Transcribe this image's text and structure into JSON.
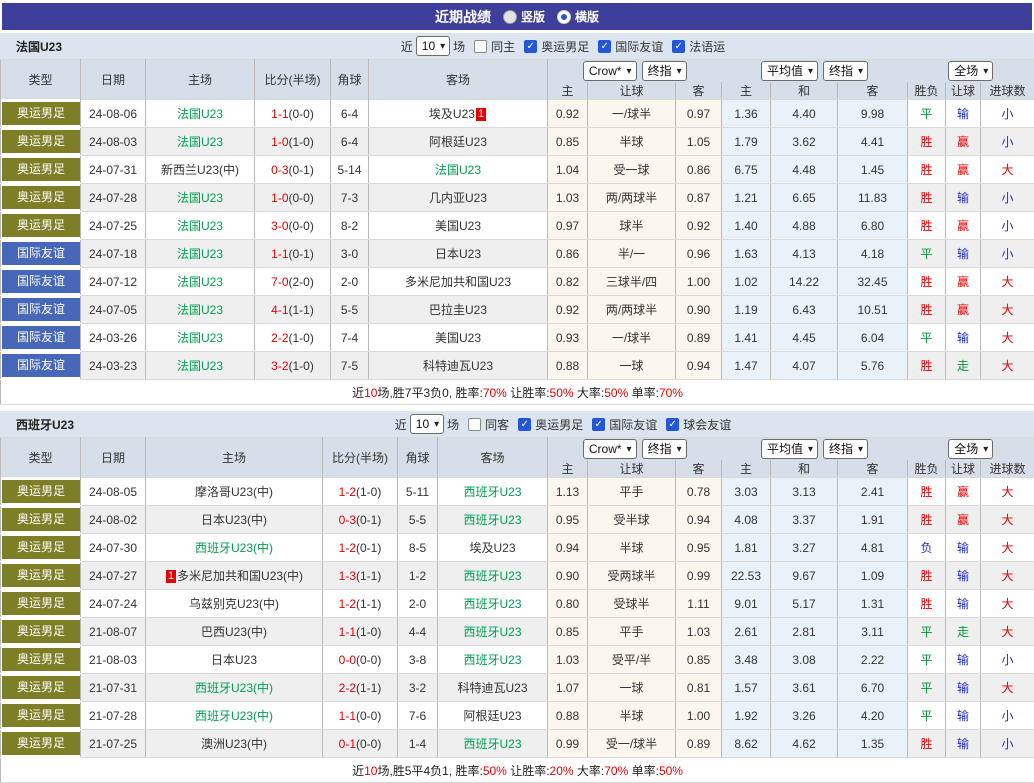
{
  "colors": {
    "titlebar": "#3e3e9b",
    "olympic_badge": "#7e7e26",
    "friendly_badge": "#4768b8",
    "team_highlight": "#00a050",
    "score_red": "#e60000",
    "result_blue": "#2230c8",
    "result_green": "#009933",
    "crow_col_bg": "#fbf6ee",
    "avg_col_bg": "#e9f2f9"
  },
  "title_bar": {
    "title": "近期战绩",
    "radio_vertical": "竖版",
    "radio_horizontal": "横版"
  },
  "table_header": {
    "type": "类型",
    "date": "日期",
    "home": "主场",
    "score": "比分(半场)",
    "corner": "角球",
    "away": "客场",
    "group1_select1": "Crow*",
    "group1_select2": "终指",
    "group1_col1": "主",
    "group1_col2": "让球",
    "group1_col3": "客",
    "group2_select1": "平均值",
    "group2_select2": "终指",
    "group2_col1": "主",
    "group2_col2": "和",
    "group2_col3": "客",
    "group3_select": "全场",
    "group3_col1": "胜负",
    "group3_col2": "让球",
    "group3_col3": "进球数"
  },
  "sections": [
    {
      "team": "法国U23",
      "filter": {
        "near": "近",
        "count": "10",
        "games": "场",
        "same": "同主",
        "leagues": [
          "奥运男足",
          "国际友谊",
          "法语运"
        ]
      },
      "rows": [
        {
          "type": "奥运男足",
          "style": "olympic",
          "date": "24-08-06",
          "home": "法国U23",
          "home_green": true,
          "home_badge": "",
          "score": "1-1",
          "half": "(0-0)",
          "corner": "6-4",
          "away": "埃及U23",
          "away_green": false,
          "away_badge": "1",
          "o1": "0.92",
          "o2": "一/球半",
          "o3": "0.97",
          "o4": "1.36",
          "o5": "4.40",
          "o6": "9.98",
          "r1": "平",
          "r1c": "green",
          "r2": "输",
          "r2c": "blue",
          "r3": "小",
          "r3c": "blue"
        },
        {
          "type": "奥运男足",
          "style": "olympic",
          "date": "24-08-03",
          "home": "法国U23",
          "home_green": true,
          "home_badge": "",
          "score": "1-0",
          "half": "(1-0)",
          "corner": "6-4",
          "away": "阿根廷U23",
          "away_green": false,
          "away_badge": "",
          "o1": "0.85",
          "o2": "半球",
          "o3": "1.05",
          "o4": "1.79",
          "o5": "3.62",
          "o6": "4.41",
          "r1": "胜",
          "r1c": "red",
          "r2": "赢",
          "r2c": "red",
          "r3": "小",
          "r3c": "blue"
        },
        {
          "type": "奥运男足",
          "style": "olympic",
          "date": "24-07-31",
          "home": "新西兰U23(中)",
          "home_green": false,
          "home_badge": "",
          "score": "0-3",
          "half": "(0-1)",
          "corner": "5-14",
          "away": "法国U23",
          "away_green": true,
          "away_badge": "",
          "o1": "1.04",
          "o2": "受一球",
          "o3": "0.86",
          "o4": "6.75",
          "o5": "4.48",
          "o6": "1.45",
          "r1": "胜",
          "r1c": "red",
          "r2": "赢",
          "r2c": "red",
          "r3": "大",
          "r3c": "red"
        },
        {
          "type": "奥运男足",
          "style": "olympic",
          "date": "24-07-28",
          "home": "法国U23",
          "home_green": true,
          "home_badge": "",
          "score": "1-0",
          "half": "(0-0)",
          "corner": "7-3",
          "away": "几内亚U23",
          "away_green": false,
          "away_badge": "",
          "o1": "1.03",
          "o2": "两/两球半",
          "o3": "0.87",
          "o4": "1.21",
          "o5": "6.65",
          "o6": "11.83",
          "r1": "胜",
          "r1c": "red",
          "r2": "输",
          "r2c": "blue",
          "r3": "小",
          "r3c": "blue"
        },
        {
          "type": "奥运男足",
          "style": "olympic",
          "date": "24-07-25",
          "home": "法国U23",
          "home_green": true,
          "home_badge": "",
          "score": "3-0",
          "half": "(0-0)",
          "corner": "8-2",
          "away": "美国U23",
          "away_green": false,
          "away_badge": "",
          "o1": "0.97",
          "o2": "球半",
          "o3": "0.92",
          "o4": "1.40",
          "o5": "4.88",
          "o6": "6.80",
          "r1": "胜",
          "r1c": "red",
          "r2": "赢",
          "r2c": "red",
          "r3": "小",
          "r3c": "blue"
        },
        {
          "type": "国际友谊",
          "style": "friendly",
          "date": "24-07-18",
          "home": "法国U23",
          "home_green": true,
          "home_badge": "",
          "score": "1-1",
          "half": "(0-1)",
          "corner": "3-0",
          "away": "日本U23",
          "away_green": false,
          "away_badge": "",
          "o1": "0.86",
          "o2": "半/一",
          "o3": "0.96",
          "o4": "1.63",
          "o5": "4.13",
          "o6": "4.18",
          "r1": "平",
          "r1c": "green",
          "r2": "输",
          "r2c": "blue",
          "r3": "小",
          "r3c": "blue"
        },
        {
          "type": "国际友谊",
          "style": "friendly",
          "date": "24-07-12",
          "home": "法国U23",
          "home_green": true,
          "home_badge": "",
          "score": "7-0",
          "half": "(2-0)",
          "corner": "2-0",
          "away": "多米尼加共和国U23",
          "away_green": false,
          "away_badge": "",
          "o1": "0.82",
          "o2": "三球半/四",
          "o3": "1.00",
          "o4": "1.02",
          "o5": "14.22",
          "o6": "32.45",
          "r1": "胜",
          "r1c": "red",
          "r2": "赢",
          "r2c": "red",
          "r3": "大",
          "r3c": "red"
        },
        {
          "type": "国际友谊",
          "style": "friendly",
          "date": "24-07-05",
          "home": "法国U23",
          "home_green": true,
          "home_badge": "",
          "score": "4-1",
          "half": "(1-1)",
          "corner": "5-5",
          "away": "巴拉圭U23",
          "away_green": false,
          "away_badge": "",
          "o1": "0.92",
          "o2": "两/两球半",
          "o3": "0.90",
          "o4": "1.19",
          "o5": "6.43",
          "o6": "10.51",
          "r1": "胜",
          "r1c": "red",
          "r2": "赢",
          "r2c": "red",
          "r3": "大",
          "r3c": "red"
        },
        {
          "type": "国际友谊",
          "style": "friendly",
          "date": "24-03-26",
          "home": "法国U23",
          "home_green": true,
          "home_badge": "",
          "score": "2-2",
          "half": "(1-0)",
          "corner": "7-4",
          "away": "美国U23",
          "away_green": false,
          "away_badge": "",
          "o1": "0.93",
          "o2": "一/球半",
          "o3": "0.89",
          "o4": "1.41",
          "o5": "4.45",
          "o6": "6.04",
          "r1": "平",
          "r1c": "green",
          "r2": "输",
          "r2c": "blue",
          "r3": "大",
          "r3c": "red"
        },
        {
          "type": "国际友谊",
          "style": "friendly",
          "date": "24-03-23",
          "home": "法国U23",
          "home_green": true,
          "home_badge": "",
          "score": "3-2",
          "half": "(1-0)",
          "corner": "7-5",
          "away": "科特迪瓦U23",
          "away_green": false,
          "away_badge": "",
          "o1": "0.88",
          "o2": "一球",
          "o3": "0.94",
          "o4": "1.47",
          "o5": "4.07",
          "o6": "5.76",
          "r1": "胜",
          "r1c": "red",
          "r2": "走",
          "r2c": "green",
          "r3": "大",
          "r3c": "red"
        }
      ],
      "summary": {
        "near": "近",
        "count": "10",
        "record": "场,胜7平3负0, 胜率:",
        "win": "70%",
        "l1": " 让胜率:",
        "handicap": "50%",
        "l2": " 大率:",
        "big": "50%",
        "l3": " 单率:",
        "single": "70%"
      }
    },
    {
      "team": "西班牙U23",
      "filter": {
        "near": "近",
        "count": "10",
        "games": "场",
        "same": "同客",
        "leagues": [
          "奥运男足",
          "国际友谊",
          "球会友谊"
        ]
      },
      "rows": [
        {
          "type": "奥运男足",
          "style": "olympic",
          "date": "24-08-05",
          "home": "摩洛哥U23(中)",
          "home_green": false,
          "home_badge": "",
          "score": "1-2",
          "half": "(1-0)",
          "corner": "5-11",
          "away": "西班牙U23",
          "away_green": true,
          "away_badge": "",
          "o1": "1.13",
          "o2": "平手",
          "o3": "0.78",
          "o4": "3.03",
          "o5": "3.13",
          "o6": "2.41",
          "r1": "胜",
          "r1c": "red",
          "r2": "赢",
          "r2c": "red",
          "r3": "大",
          "r3c": "red"
        },
        {
          "type": "奥运男足",
          "style": "olympic",
          "date": "24-08-02",
          "home": "日本U23(中)",
          "home_green": false,
          "home_badge": "",
          "score": "0-3",
          "half": "(0-1)",
          "corner": "5-5",
          "away": "西班牙U23",
          "away_green": true,
          "away_badge": "",
          "o1": "0.95",
          "o2": "受半球",
          "o3": "0.94",
          "o4": "4.08",
          "o5": "3.37",
          "o6": "1.91",
          "r1": "胜",
          "r1c": "red",
          "r2": "赢",
          "r2c": "red",
          "r3": "大",
          "r3c": "red"
        },
        {
          "type": "奥运男足",
          "style": "olympic",
          "date": "24-07-30",
          "home": "西班牙U23(中)",
          "home_green": true,
          "home_badge": "",
          "score": "1-2",
          "half": "(0-1)",
          "corner": "8-5",
          "away": "埃及U23",
          "away_green": false,
          "away_badge": "",
          "o1": "0.94",
          "o2": "半球",
          "o3": "0.95",
          "o4": "1.81",
          "o5": "3.27",
          "o6": "4.81",
          "r1": "负",
          "r1c": "blue",
          "r2": "输",
          "r2c": "blue",
          "r3": "大",
          "r3c": "red"
        },
        {
          "type": "奥运男足",
          "style": "olympic",
          "date": "24-07-27",
          "home": "多米尼加共和国U23(中)",
          "home_green": false,
          "home_badge": "1",
          "score": "1-3",
          "half": "(1-1)",
          "corner": "1-2",
          "away": "西班牙U23",
          "away_green": true,
          "away_badge": "",
          "o1": "0.90",
          "o2": "受两球半",
          "o3": "0.99",
          "o4": "22.53",
          "o5": "9.67",
          "o6": "1.09",
          "r1": "胜",
          "r1c": "red",
          "r2": "输",
          "r2c": "blue",
          "r3": "大",
          "r3c": "red"
        },
        {
          "type": "奥运男足",
          "style": "olympic",
          "date": "24-07-24",
          "home": "乌兹别克U23(中)",
          "home_green": false,
          "home_badge": "",
          "score": "1-2",
          "half": "(1-1)",
          "corner": "2-0",
          "away": "西班牙U23",
          "away_green": true,
          "away_badge": "",
          "o1": "0.80",
          "o2": "受球半",
          "o3": "1.11",
          "o4": "9.01",
          "o5": "5.17",
          "o6": "1.31",
          "r1": "胜",
          "r1c": "red",
          "r2": "输",
          "r2c": "blue",
          "r3": "大",
          "r3c": "red"
        },
        {
          "type": "奥运男足",
          "style": "olympic",
          "date": "21-08-07",
          "home": "巴西U23(中)",
          "home_green": false,
          "home_badge": "",
          "score": "1-1",
          "half": "(1-0)",
          "corner": "4-4",
          "away": "西班牙U23",
          "away_green": true,
          "away_badge": "",
          "o1": "0.85",
          "o2": "平手",
          "o3": "1.03",
          "o4": "2.61",
          "o5": "2.81",
          "o6": "3.11",
          "r1": "平",
          "r1c": "green",
          "r2": "走",
          "r2c": "green",
          "r3": "大",
          "r3c": "red"
        },
        {
          "type": "奥运男足",
          "style": "olympic",
          "date": "21-08-03",
          "home": "日本U23",
          "home_green": false,
          "home_badge": "",
          "score": "0-0",
          "half": "(0-0)",
          "corner": "3-8",
          "away": "西班牙U23",
          "away_green": true,
          "away_badge": "",
          "o1": "1.03",
          "o2": "受平/半",
          "o3": "0.85",
          "o4": "3.48",
          "o5": "3.08",
          "o6": "2.22",
          "r1": "平",
          "r1c": "green",
          "r2": "输",
          "r2c": "blue",
          "r3": "小",
          "r3c": "blue"
        },
        {
          "type": "奥运男足",
          "style": "olympic",
          "date": "21-07-31",
          "home": "西班牙U23(中)",
          "home_green": true,
          "home_badge": "",
          "score": "2-2",
          "half": "(1-1)",
          "corner": "3-2",
          "away": "科特迪瓦U23",
          "away_green": false,
          "away_badge": "",
          "o1": "1.07",
          "o2": "一球",
          "o3": "0.81",
          "o4": "1.57",
          "o5": "3.61",
          "o6": "6.70",
          "r1": "平",
          "r1c": "green",
          "r2": "输",
          "r2c": "blue",
          "r3": "大",
          "r3c": "red"
        },
        {
          "type": "奥运男足",
          "style": "olympic",
          "date": "21-07-28",
          "home": "西班牙U23(中)",
          "home_green": true,
          "home_badge": "",
          "score": "1-1",
          "half": "(0-0)",
          "corner": "7-6",
          "away": "阿根廷U23",
          "away_green": false,
          "away_badge": "",
          "o1": "0.88",
          "o2": "半球",
          "o3": "1.00",
          "o4": "1.92",
          "o5": "3.26",
          "o6": "4.20",
          "r1": "平",
          "r1c": "green",
          "r2": "输",
          "r2c": "blue",
          "r3": "小",
          "r3c": "blue"
        },
        {
          "type": "奥运男足",
          "style": "olympic",
          "date": "21-07-25",
          "home": "澳洲U23(中)",
          "home_green": false,
          "home_badge": "",
          "score": "0-1",
          "half": "(0-0)",
          "corner": "1-4",
          "away": "西班牙U23",
          "away_green": true,
          "away_badge": "",
          "o1": "0.99",
          "o2": "受一/球半",
          "o3": "0.89",
          "o4": "8.62",
          "o5": "4.62",
          "o6": "1.35",
          "r1": "胜",
          "r1c": "red",
          "r2": "输",
          "r2c": "blue",
          "r3": "小",
          "r3c": "blue"
        }
      ],
      "summary": {
        "near": "近",
        "count": "10",
        "record": "场,胜5平4负1, 胜率:",
        "win": "50%",
        "l1": " 让胜率:",
        "handicap": "20%",
        "l2": " 大率:",
        "big": "70%",
        "l3": " 单率:",
        "single": "50%"
      }
    }
  ]
}
